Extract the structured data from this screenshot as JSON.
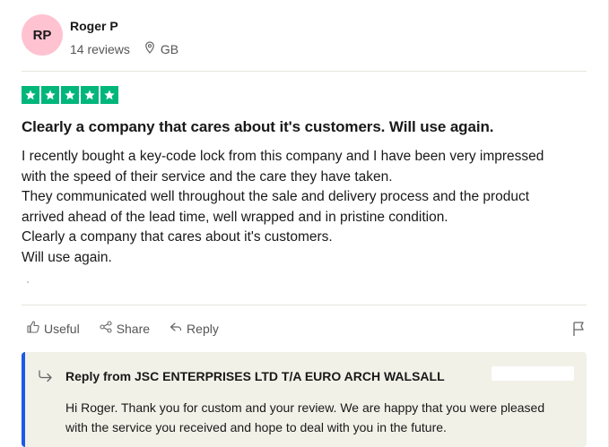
{
  "reviewer": {
    "initials": "RP",
    "name": "Roger P",
    "review_count": "14 reviews",
    "country": "GB",
    "avatar_color": "#ffc2d1"
  },
  "rating": {
    "stars": 5,
    "max": 5,
    "color": "#00b67a"
  },
  "review": {
    "title": "Clearly a company that cares about it's customers. Will use again.",
    "lines": [
      "I recently bought a key-code lock from this company and I have been very impressed",
      "with the speed of their service and the care they have taken.",
      "They communicated well throughout the sale and delivery process and the product",
      "arrived ahead of the lead time, well wrapped and in pristine condition.",
      "Clearly a company that cares about it's customers.",
      "Will use again."
    ]
  },
  "actions": {
    "useful": "Useful",
    "share": "Share",
    "reply": "Reply"
  },
  "company_reply": {
    "title": "Reply from JSC ENTERPRISES LTD T/A EURO ARCH WALSALL",
    "text_lines": [
      "Hi Roger. Thank you for custom and your review. We are happy that you were pleased",
      "with the service you received and hope to deal with you in the future."
    ],
    "accent": "#1c5ae6"
  },
  "icons": {
    "location": "map-pin-icon",
    "star": "star-icon",
    "useful": "thumbs-up-icon",
    "share": "share-icon",
    "reply": "reply-arrow-icon",
    "flag": "flag-icon",
    "company_reply": "reply-indent-icon"
  }
}
